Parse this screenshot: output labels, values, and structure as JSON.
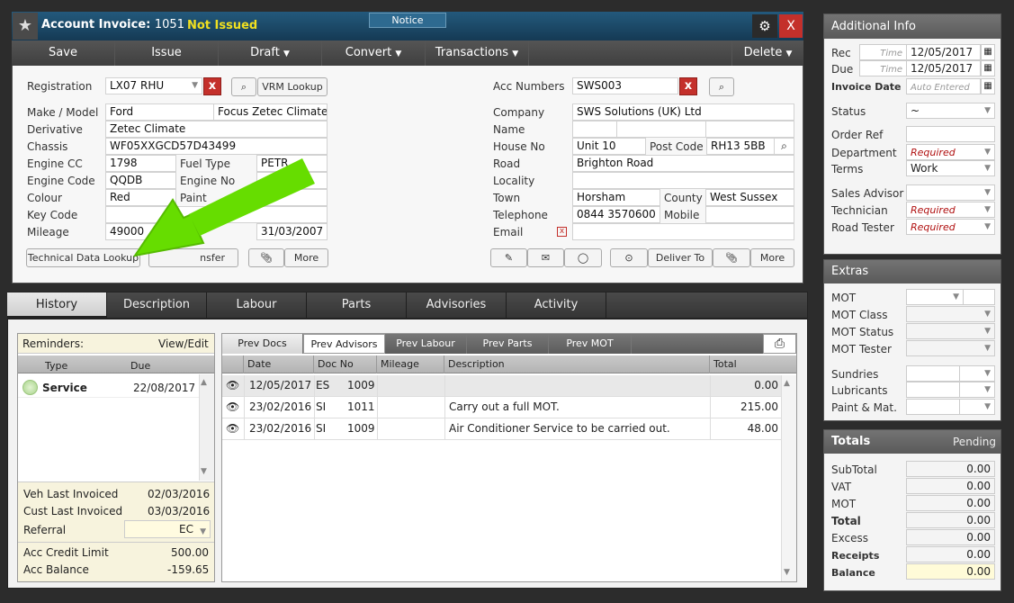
{
  "window": {
    "title": "Account Invoice:",
    "number": "1051",
    "status": "Not Issued",
    "notice": "Notice"
  },
  "menu": {
    "save": "Save",
    "issue": "Issue",
    "draft": "Draft",
    "convert": "Convert",
    "transactions": "Transactions",
    "delete": "Delete"
  },
  "vehicle": {
    "registration_label": "Registration",
    "registration": "LX07 RHU",
    "vrm_lookup": "VRM Lookup",
    "make_model_label": "Make / Model",
    "make": "Ford",
    "model": "Focus Zetec Climate",
    "derivative_label": "Derivative",
    "derivative": "Zetec Climate",
    "chassis_label": "Chassis",
    "chassis": "WF05XXGCD57D43499",
    "engine_cc_label": "Engine CC",
    "engine_cc": "1798",
    "fuel_type_label": "Fuel Type",
    "fuel_type": "PETR",
    "engine_code_label": "Engine Code",
    "engine_code": "QQDB",
    "engine_no_label": "Engine No",
    "colour_label": "Colour",
    "colour": "Red",
    "paint_label": "Paint",
    "key_code_label": "Key Code",
    "mileage_label": "Mileage",
    "mileage": "49000",
    "date": "31/03/2007",
    "tech_lookup": "Technical Data Lookup",
    "transfer": "nsfer",
    "more": "More"
  },
  "customer": {
    "acc_numbers_label": "Acc Numbers",
    "acc_number": "SWS003",
    "company_label": "Company",
    "company": "SWS Solutions (UK) Ltd",
    "name_label": "Name",
    "house_no_label": "House No",
    "house_no": "Unit 10",
    "post_code_label": "Post Code",
    "post_code": "RH13 5BB",
    "road_label": "Road",
    "road": "Brighton Road",
    "locality_label": "Locality",
    "town_label": "Town",
    "town": "Horsham",
    "county_label": "County",
    "county": "West Sussex",
    "telephone_label": "Telephone",
    "telephone": "0844 3570600",
    "mobile_label": "Mobile",
    "email_label": "Email",
    "deliver_to": "Deliver To",
    "more": "More"
  },
  "tabs": [
    "History",
    "Description",
    "Labour",
    "Parts",
    "Advisories",
    "Activity"
  ],
  "reminders": {
    "title": "Reminders:",
    "view_edit": "View/Edit",
    "col_type": "Type",
    "col_due": "Due",
    "items": [
      {
        "type": "Service",
        "due": "22/08/2017"
      }
    ],
    "veh_last_label": "Veh Last Invoiced",
    "veh_last": "02/03/2016",
    "cust_last_label": "Cust Last Invoiced",
    "cust_last": "03/03/2016",
    "referral_label": "Referral",
    "referral": "EC",
    "credit_label": "Acc Credit Limit",
    "credit": "500.00",
    "balance_label": "Acc Balance",
    "balance": "-159.65"
  },
  "history": {
    "subtabs": [
      "Prev Docs",
      "Prev Advisors",
      "Prev Labour",
      "Prev Parts",
      "Prev MOT"
    ],
    "columns": [
      "Date",
      "Doc No",
      "Mileage",
      "Description",
      "Total"
    ],
    "rows": [
      {
        "date": "12/05/2017",
        "type": "ES",
        "doc": "1009",
        "desc": "",
        "total": "0.00"
      },
      {
        "date": "23/02/2016",
        "type": "SI",
        "doc": "1011",
        "desc": "Carry out a full MOT.",
        "total": "215.00"
      },
      {
        "date": "23/02/2016",
        "type": "SI",
        "doc": "1009",
        "desc": "Air Conditioner Service to be carried out.",
        "total": "48.00"
      }
    ]
  },
  "additional": {
    "title": "Additional Info",
    "rec_label": "Rec",
    "due_label": "Due",
    "time_ph": "Time",
    "rec_date": "12/05/2017",
    "due_date": "12/05/2017",
    "invoice_date_label": "Invoice Date",
    "auto_entered": "Auto Entered",
    "status_label": "Status",
    "status": "~",
    "order_ref_label": "Order Ref",
    "department_label": "Department",
    "required": "Required",
    "terms_label": "Terms",
    "terms": "Work",
    "sales_advisor_label": "Sales Advisor",
    "technician_label": "Technician",
    "road_tester_label": "Road Tester"
  },
  "extras": {
    "title": "Extras",
    "mot": "MOT",
    "mot_class": "MOT Class",
    "mot_status": "MOT Status",
    "mot_tester": "MOT Tester",
    "sundries": "Sundries",
    "lubricants": "Lubricants",
    "paint_mat": "Paint & Mat."
  },
  "totals": {
    "title": "Totals",
    "state": "Pending",
    "rows": [
      {
        "label": "SubTotal",
        "value": "0.00"
      },
      {
        "label": "VAT",
        "value": "0.00"
      },
      {
        "label": "MOT",
        "value": "0.00"
      },
      {
        "label": "Total",
        "value": "0.00"
      },
      {
        "label": "Excess",
        "value": "0.00"
      },
      {
        "label": "Receipts",
        "value": "0.00"
      },
      {
        "label": "Balance",
        "value": "0.00"
      }
    ]
  },
  "colors": {
    "accent": "#f0e020",
    "close": "#c4302b",
    "arrow": "#66dd00",
    "header": "#1e4d6b"
  }
}
